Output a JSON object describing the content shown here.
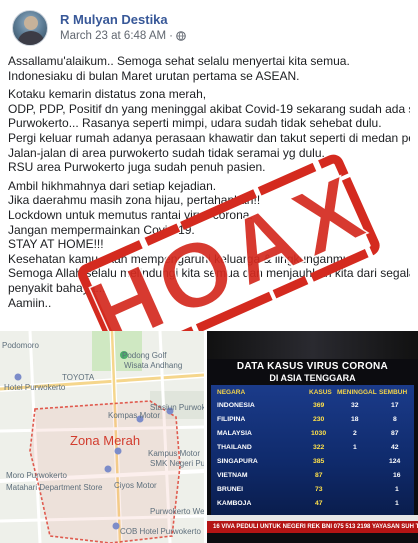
{
  "post": {
    "author": "R Mulyan Destika",
    "timestamp": "March 23 at 6:48 AM",
    "privacy_sep": "·",
    "lines": [
      "Assallamu'alaikum.. Semoga sehat selalu menyertai kita semua.",
      "Indonesiaku di bulan Maret urutan pertama se ASEAN.",
      "Kotaku kemarin distatus zona merah,",
      "ODP, PDP, Positif dn yang meninggal akibat Covid-19 sekarang sudah ada semua",
      "Purwokerto... Rasanya seperti mimpi, udara sudah tidak sehebat dulu.",
      "Pergi keluar rumah adanya perasaan khawatir dan takut seperti di medan perang.",
      "Jalan-jalan di area purwokerto sudah tidak seramai yg dulu.",
      "RSU area Purwokerto juga sudah penuh pasien.",
      "Ambil hikhmahnya dari setiap kejadian.",
      "Jika daerahmu masih zona hijau, pertahankan!!",
      "Lockdown untuk memutus rantai virus corona.",
      "Jangan mempermainkan Covid-19.",
      "STAY AT HOME!!!",
      "Kesehatan kamu akan mempengaruhi keluarga & lingkunganmu.",
      "Semoga Allah selalu melindungi kita semua dan menjauhkan kita dari segala",
      "penyakit bahaya...",
      "Aamiin.."
    ]
  },
  "stamp": {
    "text": "HOAX",
    "color": "#d42a1f"
  },
  "map": {
    "zone_label": "Zona Merah",
    "places": [
      "Podomoro",
      "Podong Golf",
      "Wisata Andhang",
      "TOYOTA",
      "Hotel Purwokerto",
      "Stasiun Purwokerto",
      "Kompas Motor",
      "Kampus Motor",
      "SMK Negeri Purwokerto",
      "Moro Purwokerto",
      "Matahari Department Store",
      "Ciyos Motor",
      "Purwokerto Wetan",
      "COB Hotel Purwokerto",
      "Hotel Purwokerto"
    ]
  },
  "tv": {
    "title": "DATA KASUS VIRUS CORONA",
    "subtitle": "DI ASIA TENGGARA",
    "headers": [
      "NEGARA",
      "KASUS",
      "MENINGGAL",
      "SEMBUH"
    ],
    "rows": [
      {
        "country": "INDONESIA",
        "cases": "369",
        "deaths": "32",
        "recovered": "17"
      },
      {
        "country": "FILIPINA",
        "cases": "230",
        "deaths": "18",
        "recovered": "8"
      },
      {
        "country": "MALAYSIA",
        "cases": "1030",
        "deaths": "2",
        "recovered": "87"
      },
      {
        "country": "THAILAND",
        "cases": "322",
        "deaths": "1",
        "recovered": "42"
      },
      {
        "country": "SINGAPURA",
        "cases": "385",
        "deaths": "",
        "recovered": "124"
      },
      {
        "country": "VIETNAM",
        "cases": "87",
        "deaths": "",
        "recovered": "16"
      },
      {
        "country": "BRUNEI",
        "cases": "73",
        "deaths": "",
        "recovered": "1"
      },
      {
        "country": "KAMBOJA",
        "cases": "47",
        "deaths": "",
        "recovered": "1"
      }
    ],
    "ticker": "16  VIVA PEDULI UNTUK NEGERI REK BNI 075 513 2198 YAYASAN SUH TVONE",
    "colors": {
      "panel": "#1b3b8a",
      "ticker": "#b41414",
      "accent": "#ffe14a"
    }
  }
}
